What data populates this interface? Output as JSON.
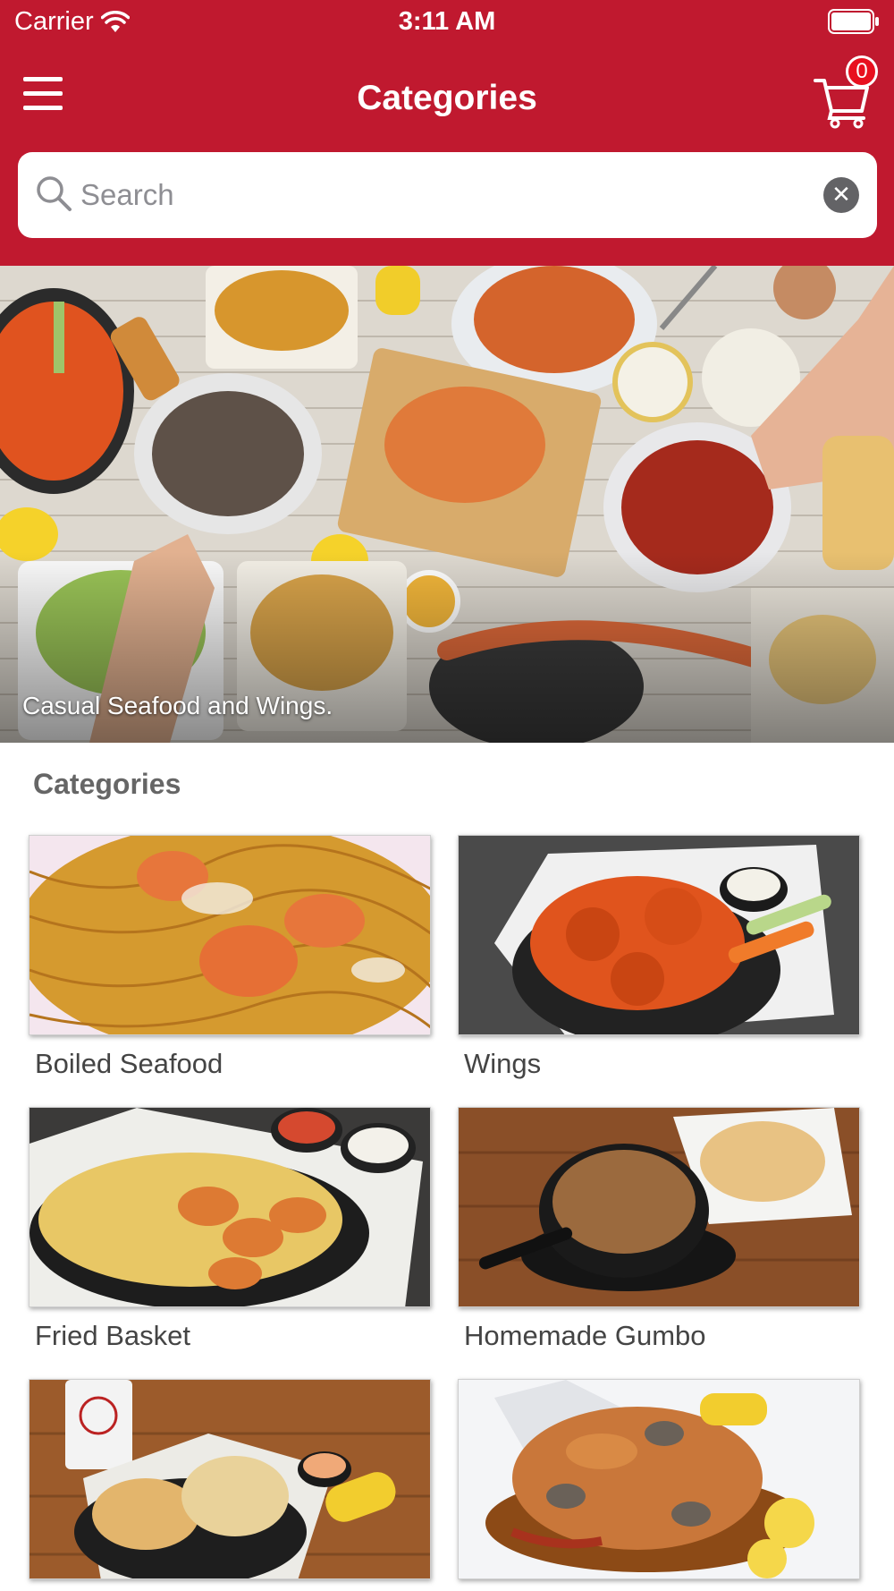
{
  "status_bar": {
    "carrier": "Carrier",
    "time": "3:11 AM"
  },
  "nav": {
    "title": "Categories",
    "cart_count": "0"
  },
  "search": {
    "placeholder": "Search",
    "value": ""
  },
  "hero": {
    "caption": "Casual Seafood and Wings."
  },
  "section": {
    "title": "Categories"
  },
  "categories": [
    {
      "label": "Boiled Seafood",
      "image": "noodles-shrimp"
    },
    {
      "label": "Wings",
      "image": "wings-basket"
    },
    {
      "label": "Fried Basket",
      "image": "fried-shrimp-fries"
    },
    {
      "label": "Homemade Gumbo",
      "image": "gumbo-bowl"
    },
    {
      "label": "",
      "image": "fish-basket"
    },
    {
      "label": "",
      "image": "seafood-boil"
    }
  ],
  "colors": {
    "brand": "#c0192f",
    "badge": "#e8101f"
  }
}
